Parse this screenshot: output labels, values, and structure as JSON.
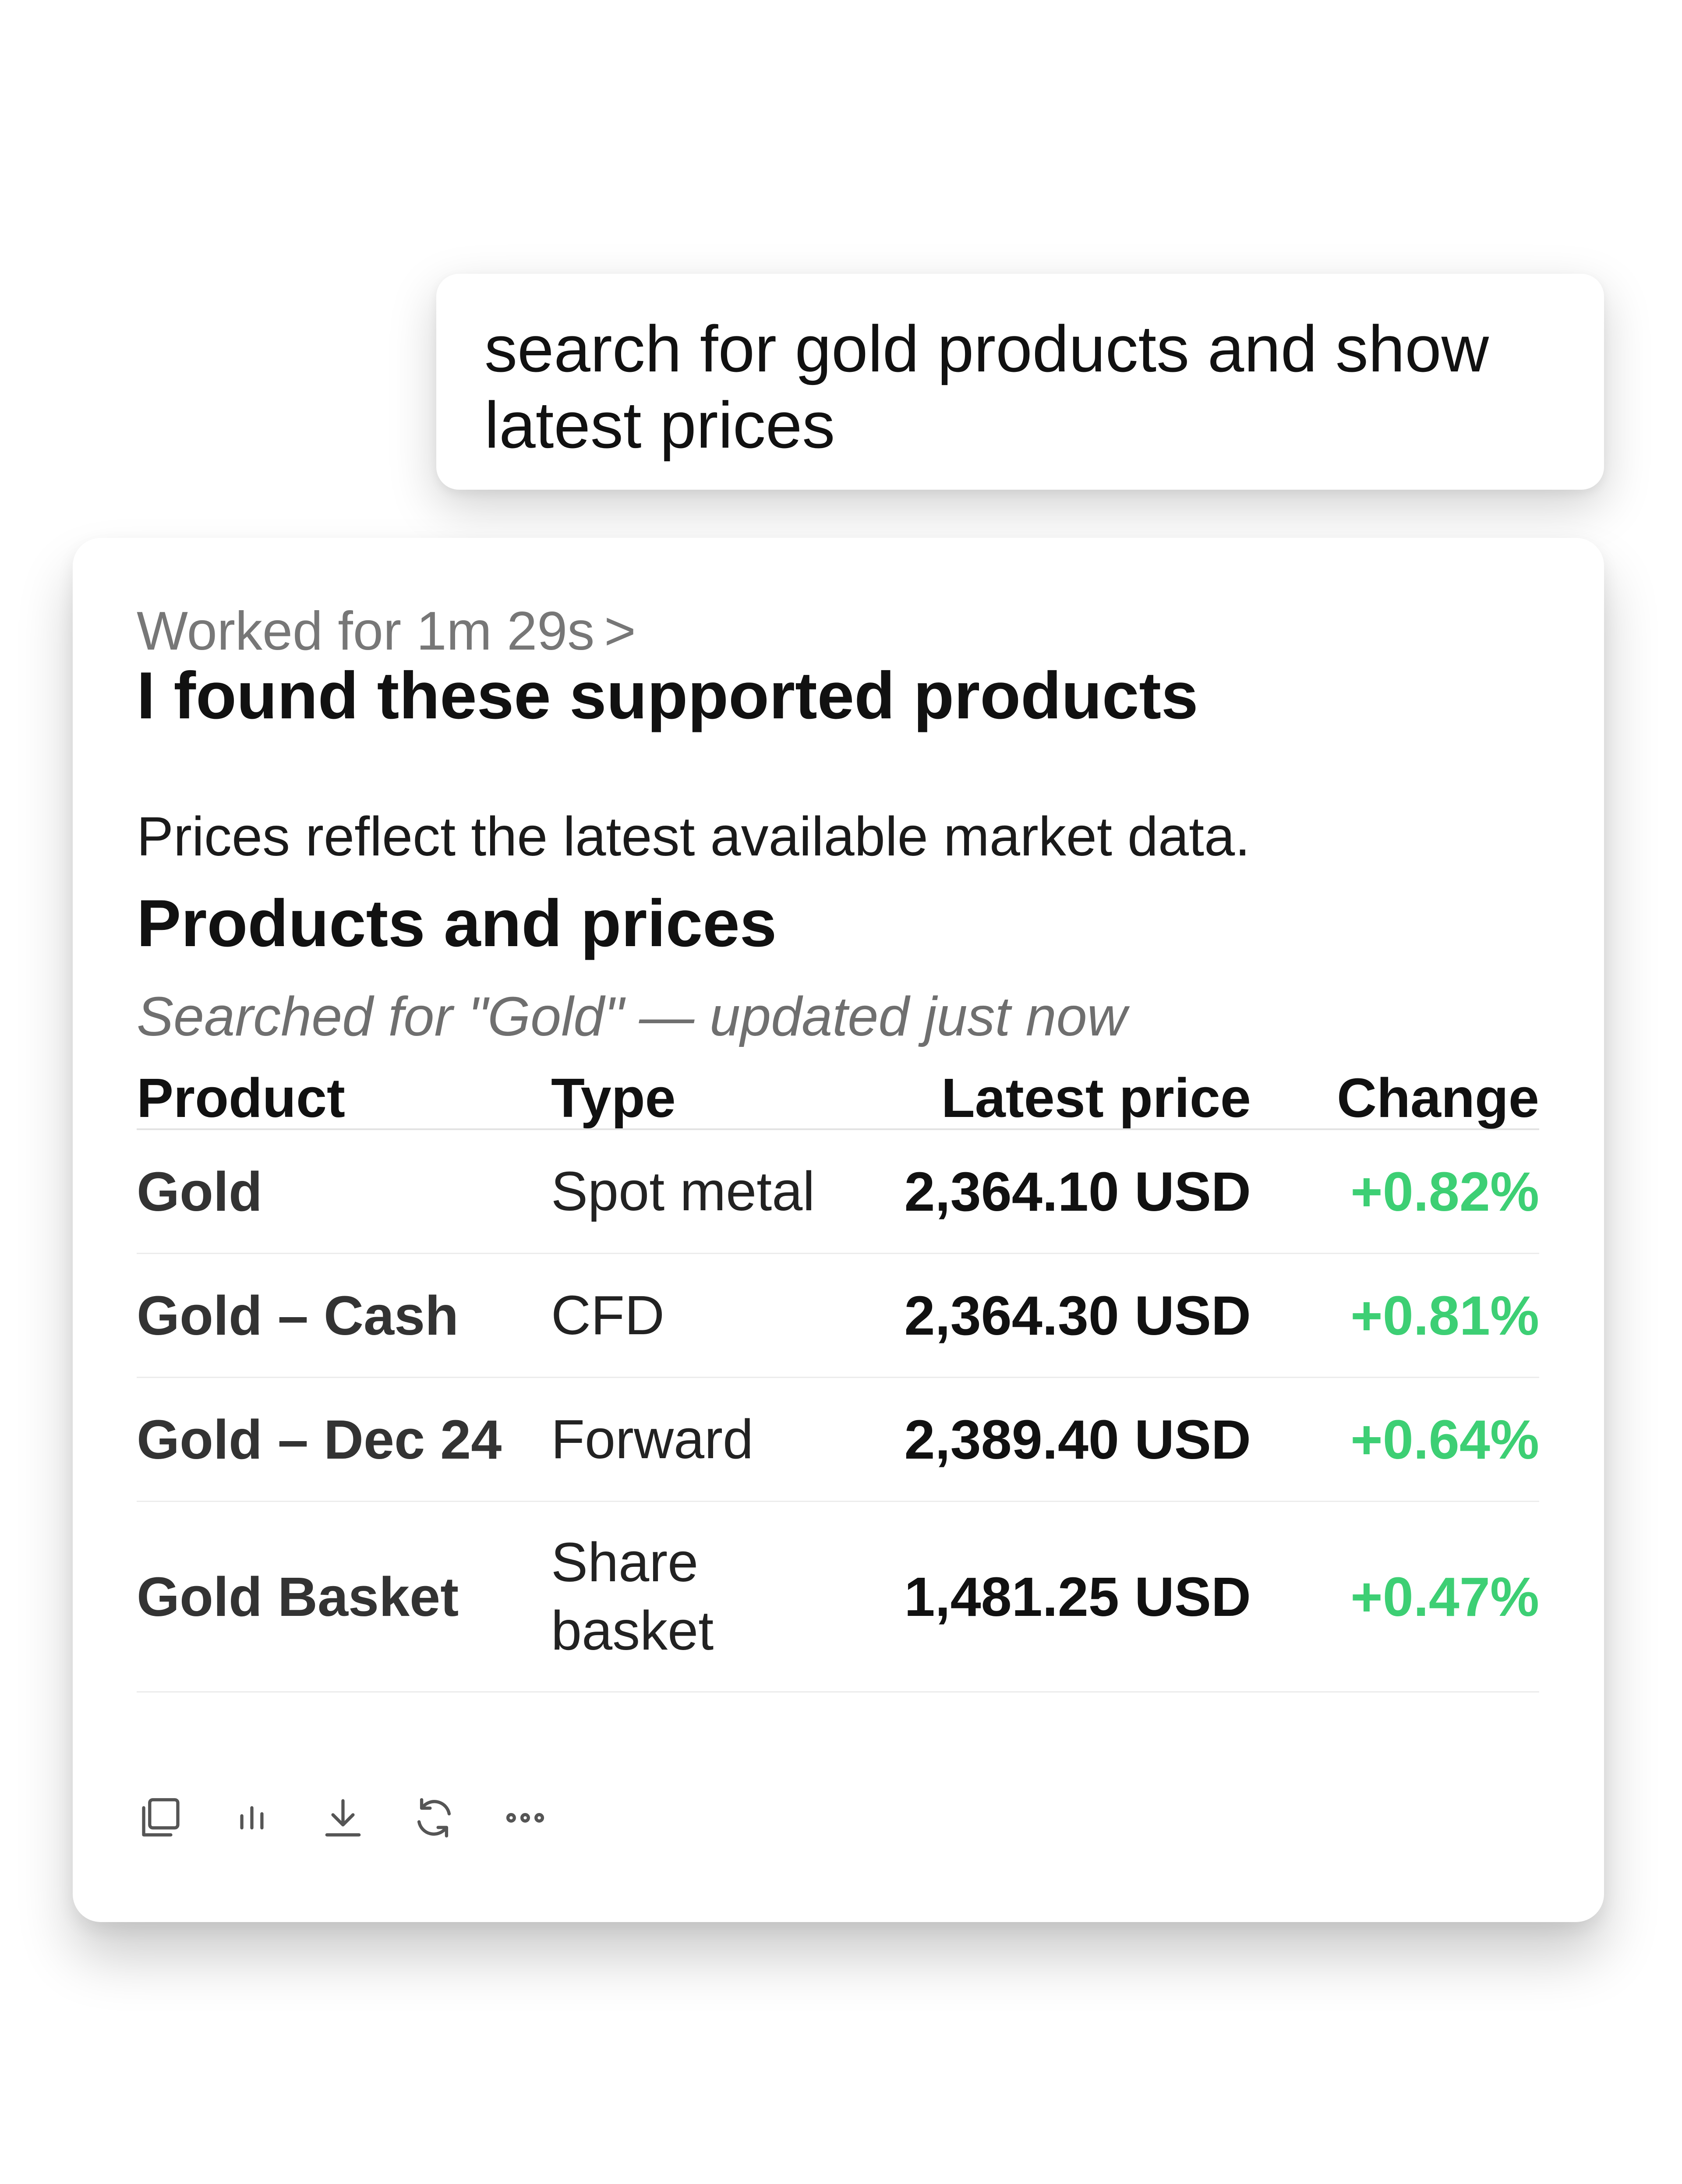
{
  "prompt": {
    "line1": "search for gold products and show",
    "line2": "latest prices"
  },
  "response": {
    "worked_for": "Worked for 1m 29s",
    "worked_for_chevron": ">",
    "heading": "I found these supported products",
    "subtext": "Prices reflect the latest available market data.",
    "section_heading": "Products and prices",
    "search_meta": "Searched for \"Gold\"  — updated just now",
    "table": {
      "columns": [
        "Product",
        "Type",
        "Latest price",
        "Change"
      ],
      "rows": [
        {
          "product": "Gold",
          "type": "Spot metal",
          "price": "2,364.10 USD",
          "change": "+0.82%"
        },
        {
          "product": "Gold – Cash",
          "type": "CFD",
          "price": "2,364.30 USD",
          "change": "+0.81%"
        },
        {
          "product": "Gold – Dec 24",
          "type": "Forward",
          "price": "2,389.40 USD",
          "change": "+0.64%"
        },
        {
          "product": "Gold Basket",
          "type_line1": "Share",
          "type_line2": "basket",
          "price": "1,481.25 USD",
          "change": "+0.47%"
        }
      ]
    },
    "toolbar": {
      "icons": [
        "copy-icon",
        "chart-icon",
        "download-icon",
        "refresh-icon",
        "more-icon"
      ]
    }
  },
  "colors": {
    "positive_change": "#3dcf74",
    "muted_text": "#777777"
  }
}
